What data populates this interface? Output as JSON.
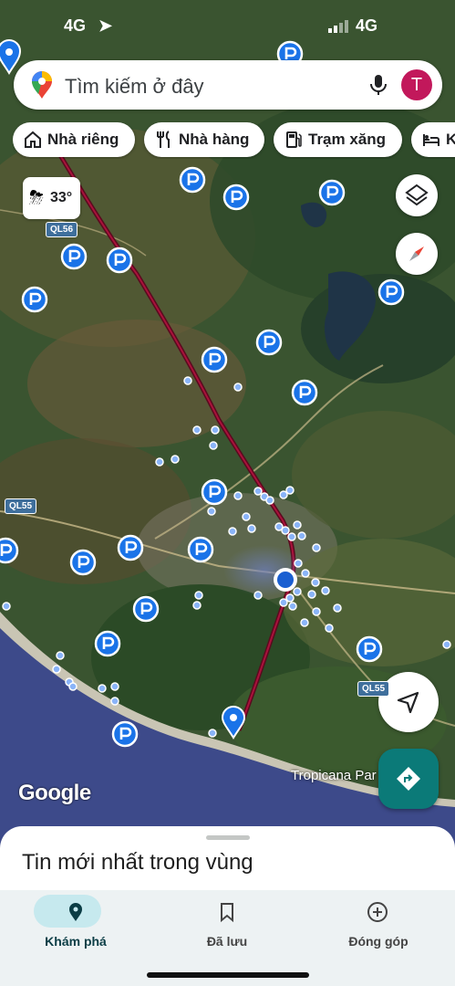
{
  "status_bar": {
    "time": "4G",
    "network": "4G"
  },
  "search": {
    "placeholder": "Tìm kiếm ở đây",
    "avatar_letter": "T"
  },
  "chips": [
    {
      "label": "Nhà riêng",
      "icon": "home-icon"
    },
    {
      "label": "Nhà hàng",
      "icon": "restaurant-icon"
    },
    {
      "label": "Trạm xăng",
      "icon": "gas-station-icon"
    },
    {
      "label": "K",
      "icon": "hotel-icon"
    }
  ],
  "weather": {
    "temperature": "33°",
    "icon": "thunderstorm-icon"
  },
  "map": {
    "attribution": "Google",
    "place_label": "Tropicana Par",
    "road_labels": [
      "QL56",
      "QL55",
      "QL55"
    ],
    "colors": {
      "route": "#7a0f2a",
      "parking": "#1a73e8",
      "location": "#1a5fd1",
      "pin": "#1a73e8"
    }
  },
  "buttons": {
    "layers": "layers-icon",
    "compass": "compass-icon",
    "my_location": "navigation-arrow-icon",
    "directions": "directions-icon"
  },
  "sheet": {
    "title": "Tin mới nhất trong vùng"
  },
  "tabs": [
    {
      "label": "Khám phá",
      "icon": "explore-pin-icon",
      "active": true
    },
    {
      "label": "Đã lưu",
      "icon": "bookmark-icon",
      "active": false
    },
    {
      "label": "Đóng góp",
      "icon": "add-circle-icon",
      "active": false
    }
  ]
}
